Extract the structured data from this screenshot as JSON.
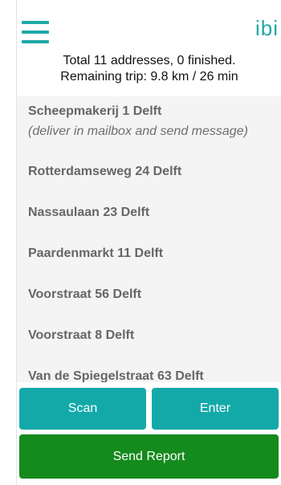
{
  "header": {
    "menu_icon": "hamburger-menu-icon",
    "brand": "ibi",
    "brand_color": "#1fa8a8"
  },
  "summary": {
    "line1": "Total 11 addresses, 0 finished.",
    "line2": "Remaining trip: 9.8 km / 26 min"
  },
  "addresses": [
    {
      "street": "Scheepmakerij 1 Delft",
      "note": "(deliver in mailbox and send message)"
    },
    {
      "street": "Rotterdamseweg 24 Delft"
    },
    {
      "street": "Nassaulaan 23 Delft"
    },
    {
      "street": "Paardenmarkt 11 Delft"
    },
    {
      "street": "Voorstraat 56 Delft"
    },
    {
      "street": "Voorstraat 8 Delft"
    },
    {
      "street": "Van de Spiegelstraat 63 Delft"
    }
  ],
  "actions": {
    "scan_label": "Scan",
    "enter_label": "Enter",
    "report_label": "Send Report"
  },
  "colors": {
    "accent": "#14a9a9",
    "report": "#158a1d",
    "list_background": "#f4f4f4"
  }
}
